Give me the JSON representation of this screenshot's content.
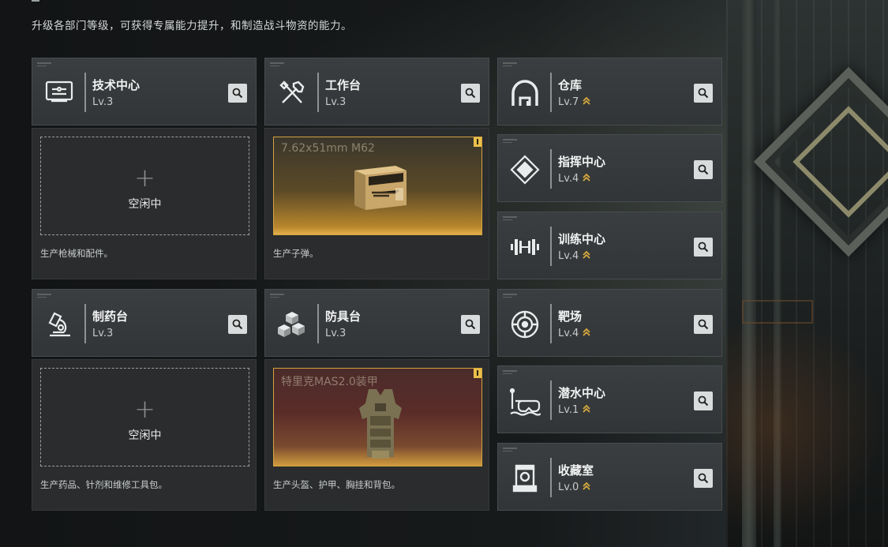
{
  "subtitle": "升级各部门等级，可获得专属能力提升，和制造战斗物资的能力。",
  "colors": {
    "accent_gold": "#d4a33d",
    "card_bg": "#3b3e40",
    "panel_bg": "#2a2c2e",
    "search_btn": "#d9dcdc"
  },
  "departments": [
    {
      "key": "tech",
      "icon": "monitor-icon",
      "title": "技术中心",
      "level": "Lv.3",
      "upgrade": false
    },
    {
      "key": "workbench",
      "icon": "tools-icon",
      "title": "工作台",
      "level": "Lv.3",
      "upgrade": false
    },
    {
      "key": "storage",
      "icon": "warehouse-icon",
      "title": "仓库",
      "level": "Lv.7",
      "upgrade": true
    },
    {
      "key": "command",
      "icon": "command-diamond-icon",
      "title": "指挥中心",
      "level": "Lv.4",
      "upgrade": true
    },
    {
      "key": "training",
      "icon": "dumbbell-icon",
      "title": "训练中心",
      "level": "Lv.4",
      "upgrade": true
    },
    {
      "key": "pharmacy",
      "icon": "microscope-icon",
      "title": "制药台",
      "level": "Lv.3",
      "upgrade": false
    },
    {
      "key": "armory",
      "icon": "cubes-icon",
      "title": "防具台",
      "level": "Lv.3",
      "upgrade": false
    },
    {
      "key": "range",
      "icon": "target-icon",
      "title": "靶场",
      "level": "Lv.4",
      "upgrade": true
    },
    {
      "key": "diving",
      "icon": "diving-mask-icon",
      "title": "潜水中心",
      "level": "Lv.1",
      "upgrade": true
    },
    {
      "key": "collection",
      "icon": "display-case-icon",
      "title": "收藏室",
      "level": "Lv.0",
      "upgrade": true
    }
  ],
  "production": {
    "tech": {
      "status": "空闲中",
      "plus": "+",
      "desc": "生产枪械和配件。"
    },
    "workbench": {
      "item": "7.62x51mm M62",
      "item_icon": "ammo-box-icon",
      "desc": "生产子弹。"
    },
    "pharmacy": {
      "status": "空闲中",
      "plus": "+",
      "desc": "生产药品、针剂和维修工具包。"
    },
    "armory": {
      "item": "特里克MAS2.0装甲",
      "item_icon": "body-armor-icon",
      "desc": "生产头盔、护甲、胸挂和背包。"
    }
  }
}
